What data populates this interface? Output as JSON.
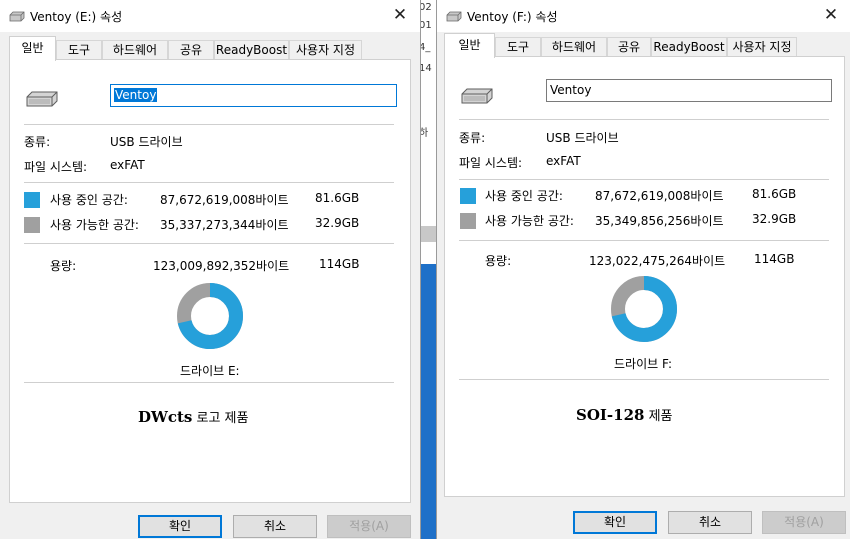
{
  "background": {
    "fragments": [
      "02",
      "01",
      "4_",
      "14",
      "하"
    ]
  },
  "windows": [
    {
      "title": "Ventoy (E:) 속성",
      "tabs": [
        "일반",
        "도구",
        "하드웨어",
        "공유",
        "ReadyBoost",
        "사용자 지정"
      ],
      "active_tab": 0,
      "volume_name": "Ventoy",
      "volume_name_selected": true,
      "type_label": "종류:",
      "type_value": "USB 드라이브",
      "fs_label": "파일 시스템:",
      "fs_value": "exFAT",
      "used_label": "사용 중인 공간:",
      "used_bytes": "87,672,619,008바이트",
      "used_size": "81.6GB",
      "free_label": "사용 가능한 공간:",
      "free_bytes": "35,337,273,344바이트",
      "free_size": "32.9GB",
      "capacity_label": "용량:",
      "capacity_bytes": "123,009,892,352바이트",
      "capacity_size": "114GB",
      "used_fraction": 0.7127,
      "drive_label": "드라이브 E:",
      "product_brand": "DWcts",
      "product_rest": " 로고 제품",
      "buttons": {
        "ok": "확인",
        "cancel": "취소",
        "apply": "적용(A)"
      },
      "colors": {
        "used": "#26a0da",
        "free": "#a0a0a0"
      }
    },
    {
      "title": "Ventoy (F:) 속성",
      "tabs": [
        "일반",
        "도구",
        "하드웨어",
        "공유",
        "ReadyBoost",
        "사용자 지정"
      ],
      "active_tab": 0,
      "volume_name": "Ventoy",
      "volume_name_selected": false,
      "type_label": "종류:",
      "type_value": "USB 드라이브",
      "fs_label": "파일 시스템:",
      "fs_value": "exFAT",
      "used_label": "사용 중인 공간:",
      "used_bytes": "87,672,619,008바이트",
      "used_size": "81.6GB",
      "free_label": "사용 가능한 공간:",
      "free_bytes": "35,349,856,256바이트",
      "free_size": "32.9GB",
      "capacity_label": "용량:",
      "capacity_bytes": "123,022,475,264바이트",
      "capacity_size": "114GB",
      "used_fraction": 0.7127,
      "drive_label": "드라이브 F:",
      "product_brand": "SOI-128",
      "product_rest": " 제품",
      "buttons": {
        "ok": "확인",
        "cancel": "취소",
        "apply": "적용(A)"
      },
      "colors": {
        "used": "#26a0da",
        "free": "#a0a0a0"
      }
    }
  ]
}
